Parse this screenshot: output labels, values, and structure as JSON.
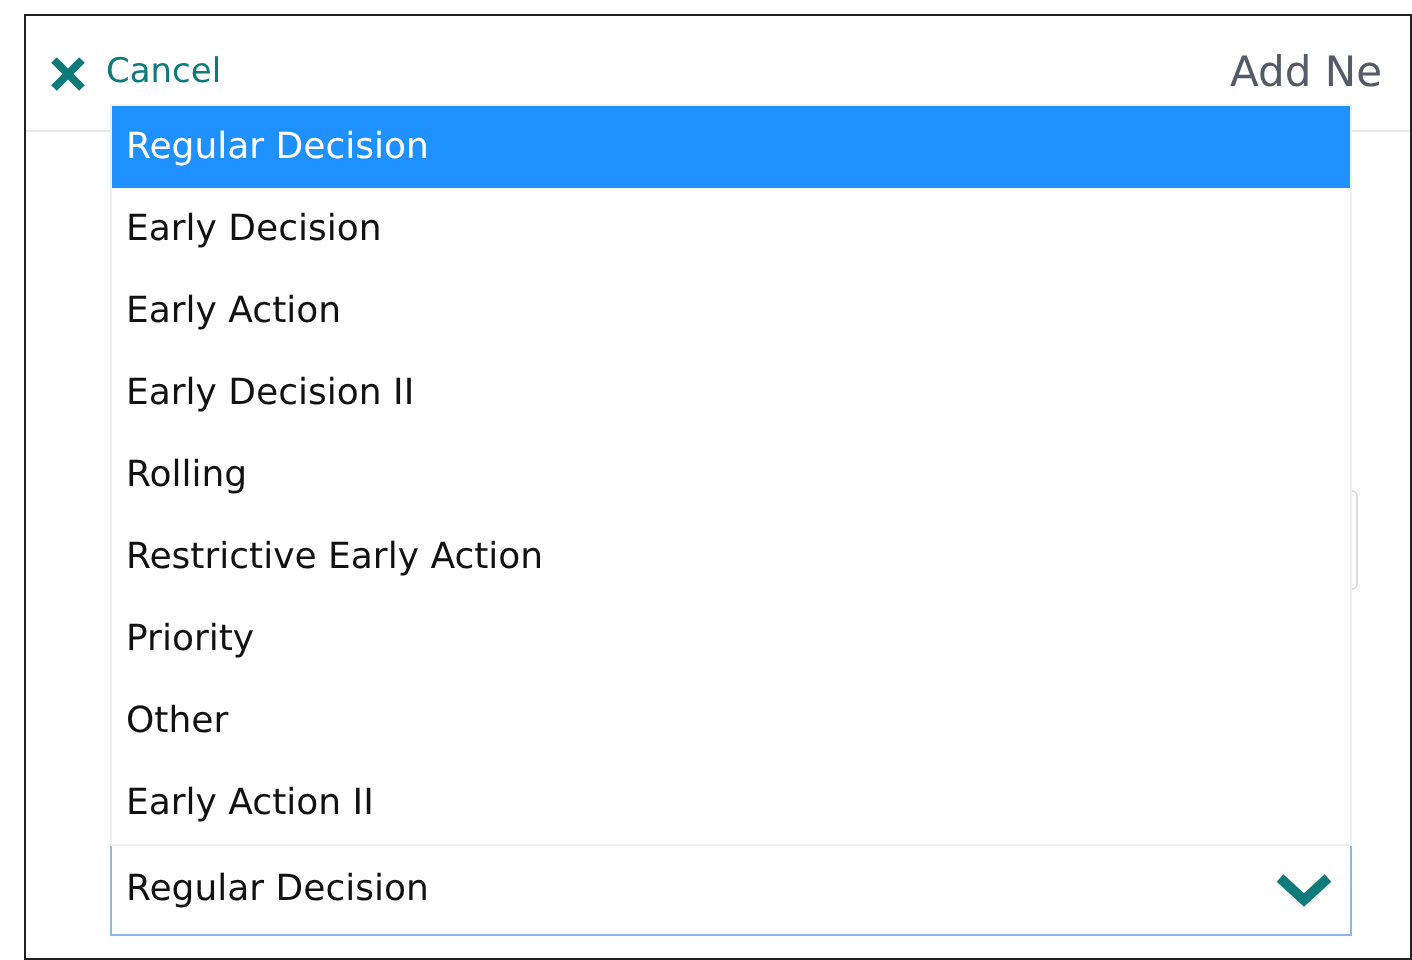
{
  "header": {
    "cancel_label": "Cancel",
    "title": "Add Ne"
  },
  "dropdown": {
    "options": [
      {
        "label": "Regular Decision",
        "selected": true
      },
      {
        "label": "Early Decision",
        "selected": false
      },
      {
        "label": "Early Action",
        "selected": false
      },
      {
        "label": "Early Decision II",
        "selected": false
      },
      {
        "label": "Rolling",
        "selected": false
      },
      {
        "label": "Restrictive Early Action",
        "selected": false
      },
      {
        "label": "Priority",
        "selected": false
      },
      {
        "label": "Other",
        "selected": false
      },
      {
        "label": "Early Action II",
        "selected": false
      }
    ],
    "value": "Regular Decision"
  }
}
